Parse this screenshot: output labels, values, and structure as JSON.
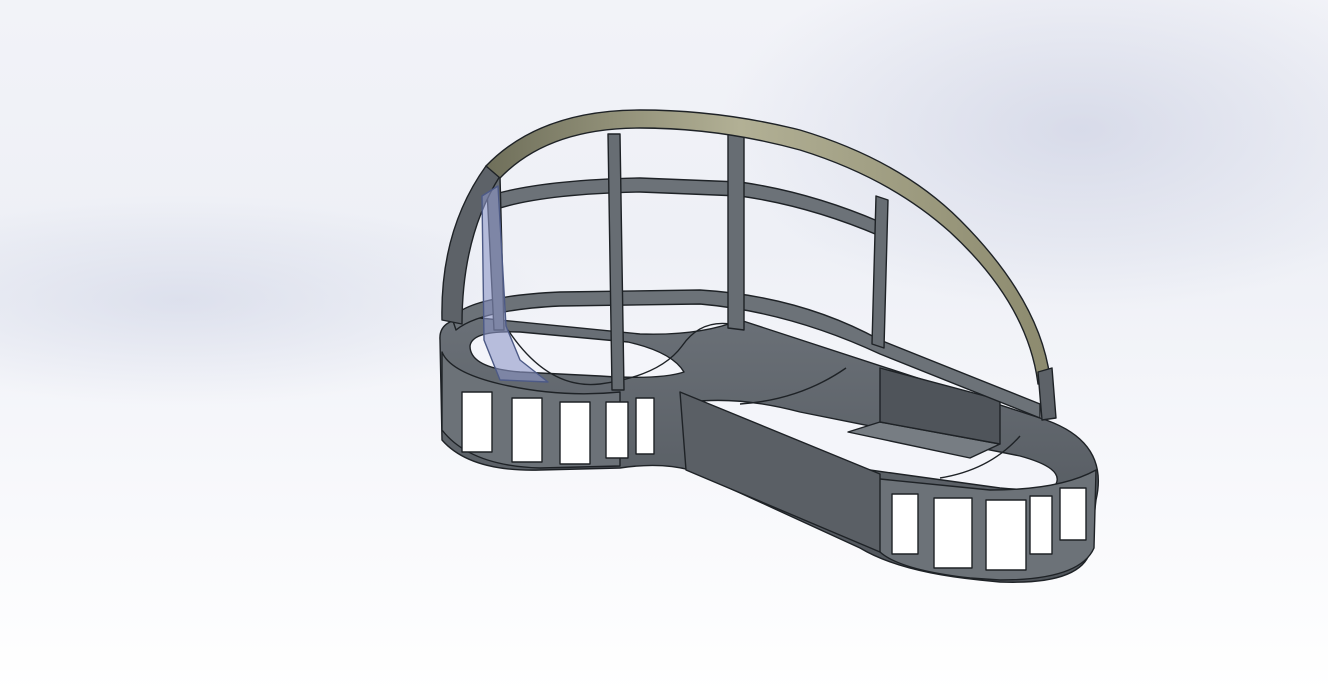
{
  "viewport": {
    "background_colors": [
      "#eef0f6",
      "#ffffff"
    ]
  },
  "model": {
    "body_color": "#5f656b",
    "body_shade_color": "#4b5056",
    "edge_color": "#1e2226",
    "rail_color": "#a8a88a",
    "glass_color": "#8d97c8"
  }
}
